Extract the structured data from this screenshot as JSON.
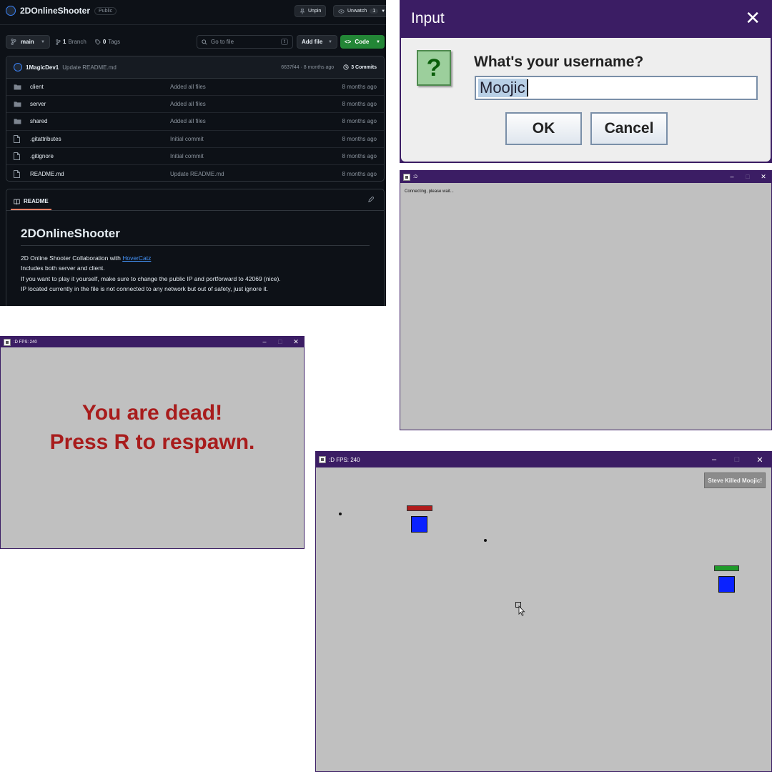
{
  "github": {
    "repo_name": "2DOnlineShooter",
    "visibility": "Public",
    "unpin_label": "Unpin",
    "unwatch_label": "Unwatch",
    "watch_count": "1",
    "branch": "main",
    "branch_count": "1",
    "branch_word": "Branch",
    "tag_count": "0",
    "tag_word": "Tags",
    "search_placeholder": "Go to file",
    "search_shortcut": "t",
    "add_file_label": "Add file",
    "code_label": "Code",
    "commit": {
      "user": "1MagicDev1",
      "message": "Update README.md",
      "hash_time": "6637f44 · 8 months ago",
      "commits_label": "3 Commits"
    },
    "files": [
      {
        "name": "client",
        "type": "folder",
        "message": "Added all files",
        "date": "8 months ago"
      },
      {
        "name": "server",
        "type": "folder",
        "message": "Added all files",
        "date": "8 months ago"
      },
      {
        "name": "shared",
        "type": "folder",
        "message": "Added all files",
        "date": "8 months ago"
      },
      {
        "name": ".gitattributes",
        "type": "file",
        "message": "Initial commit",
        "date": "8 months ago"
      },
      {
        "name": ".gitignore",
        "type": "file",
        "message": "Initial commit",
        "date": "8 months ago"
      },
      {
        "name": "README.md",
        "type": "file",
        "message": "Update README.md",
        "date": "8 months ago"
      }
    ],
    "readme": {
      "tab_label": "README",
      "title": "2DOnlineShooter",
      "line1_prefix": "2D Online Shooter Collaboration with ",
      "line1_link": "HoverCatz",
      "line2": "Includes both server and client.",
      "line3": "If you want to play it yourself, make sure to change the public IP and portforward to 42069 (nice).",
      "line4": "IP located currently in the file is not connected to any network but out of safety, just ignore it."
    }
  },
  "input_dialog": {
    "title": "Input",
    "prompt": "What's your username?",
    "value": "Moojic",
    "ok_label": "OK",
    "cancel_label": "Cancel"
  },
  "connecting_window": {
    "title": ":D",
    "status": "Connecting, please wait..."
  },
  "dead_window": {
    "title": ":D FPS: 240",
    "line1": "You are dead!",
    "line2": "Press R to respawn."
  },
  "game_window": {
    "title": ":D FPS: 240",
    "kill_feed": "Steve Killed Moojic!",
    "colors": {
      "player": "#0a22ff",
      "enemy_health": "#b01c1c",
      "self_health": "#1f9a2a",
      "background": "#c0c0c0",
      "titlebar": "#3b1d64"
    }
  }
}
